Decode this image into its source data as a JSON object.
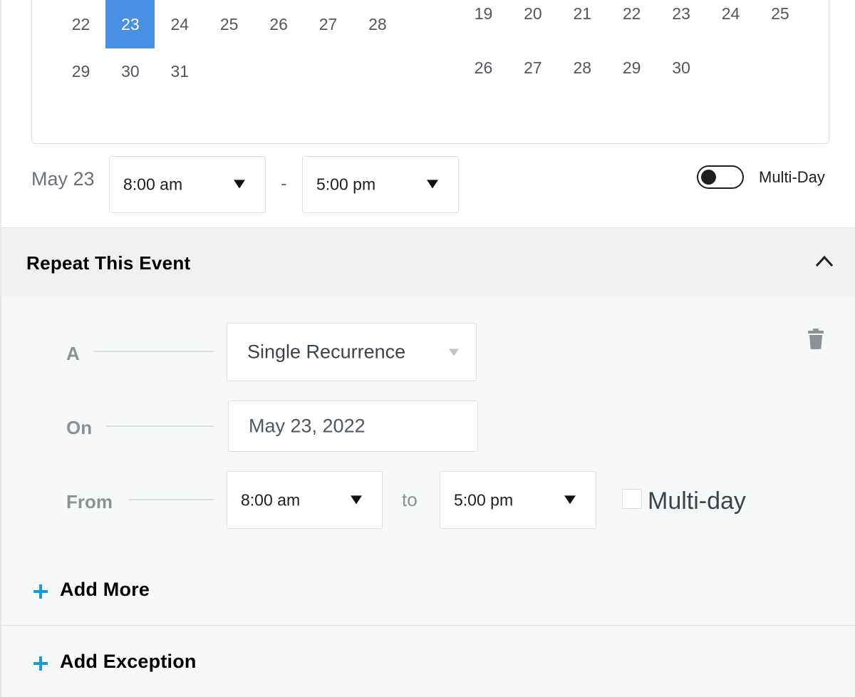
{
  "calendar": {
    "left_month": {
      "weeks": [
        [
          "22",
          "23",
          "24",
          "25",
          "26",
          "27",
          "28"
        ],
        [
          "29",
          "30",
          "31"
        ]
      ],
      "selected_day": "23"
    },
    "right_month": {
      "weeks": [
        [
          "19",
          "20",
          "21",
          "22",
          "23",
          "24",
          "25"
        ],
        [
          "26",
          "27",
          "28",
          "29",
          "30"
        ]
      ]
    }
  },
  "time_row": {
    "date_label": "May 23",
    "start_time": "8:00 am",
    "separator": "-",
    "end_time": "5:00 pm",
    "multi_day_label": "Multi-Day",
    "multi_day_enabled": false
  },
  "repeat": {
    "title": "Repeat This Event",
    "rule": {
      "a_label": "A",
      "recurrence_type": "Single Recurrence",
      "on_label": "On",
      "on_date": "May 23, 2022",
      "from_label": "From",
      "from_time": "8:00 am",
      "to_label": "to",
      "to_time": "5:00 pm",
      "multi_day_label": "Multi-day",
      "multi_day_checked": false
    },
    "add_more_label": "Add More",
    "add_exception_label": "Add Exception"
  },
  "colors": {
    "selected_day_bg": "#4a90e2",
    "plus_accent": "#1a9ad6"
  },
  "icons": {
    "toggle": "toggle-switch-icon",
    "chevron": "chevron-up-icon",
    "trash": "trash-icon",
    "plus": "plus-icon"
  }
}
